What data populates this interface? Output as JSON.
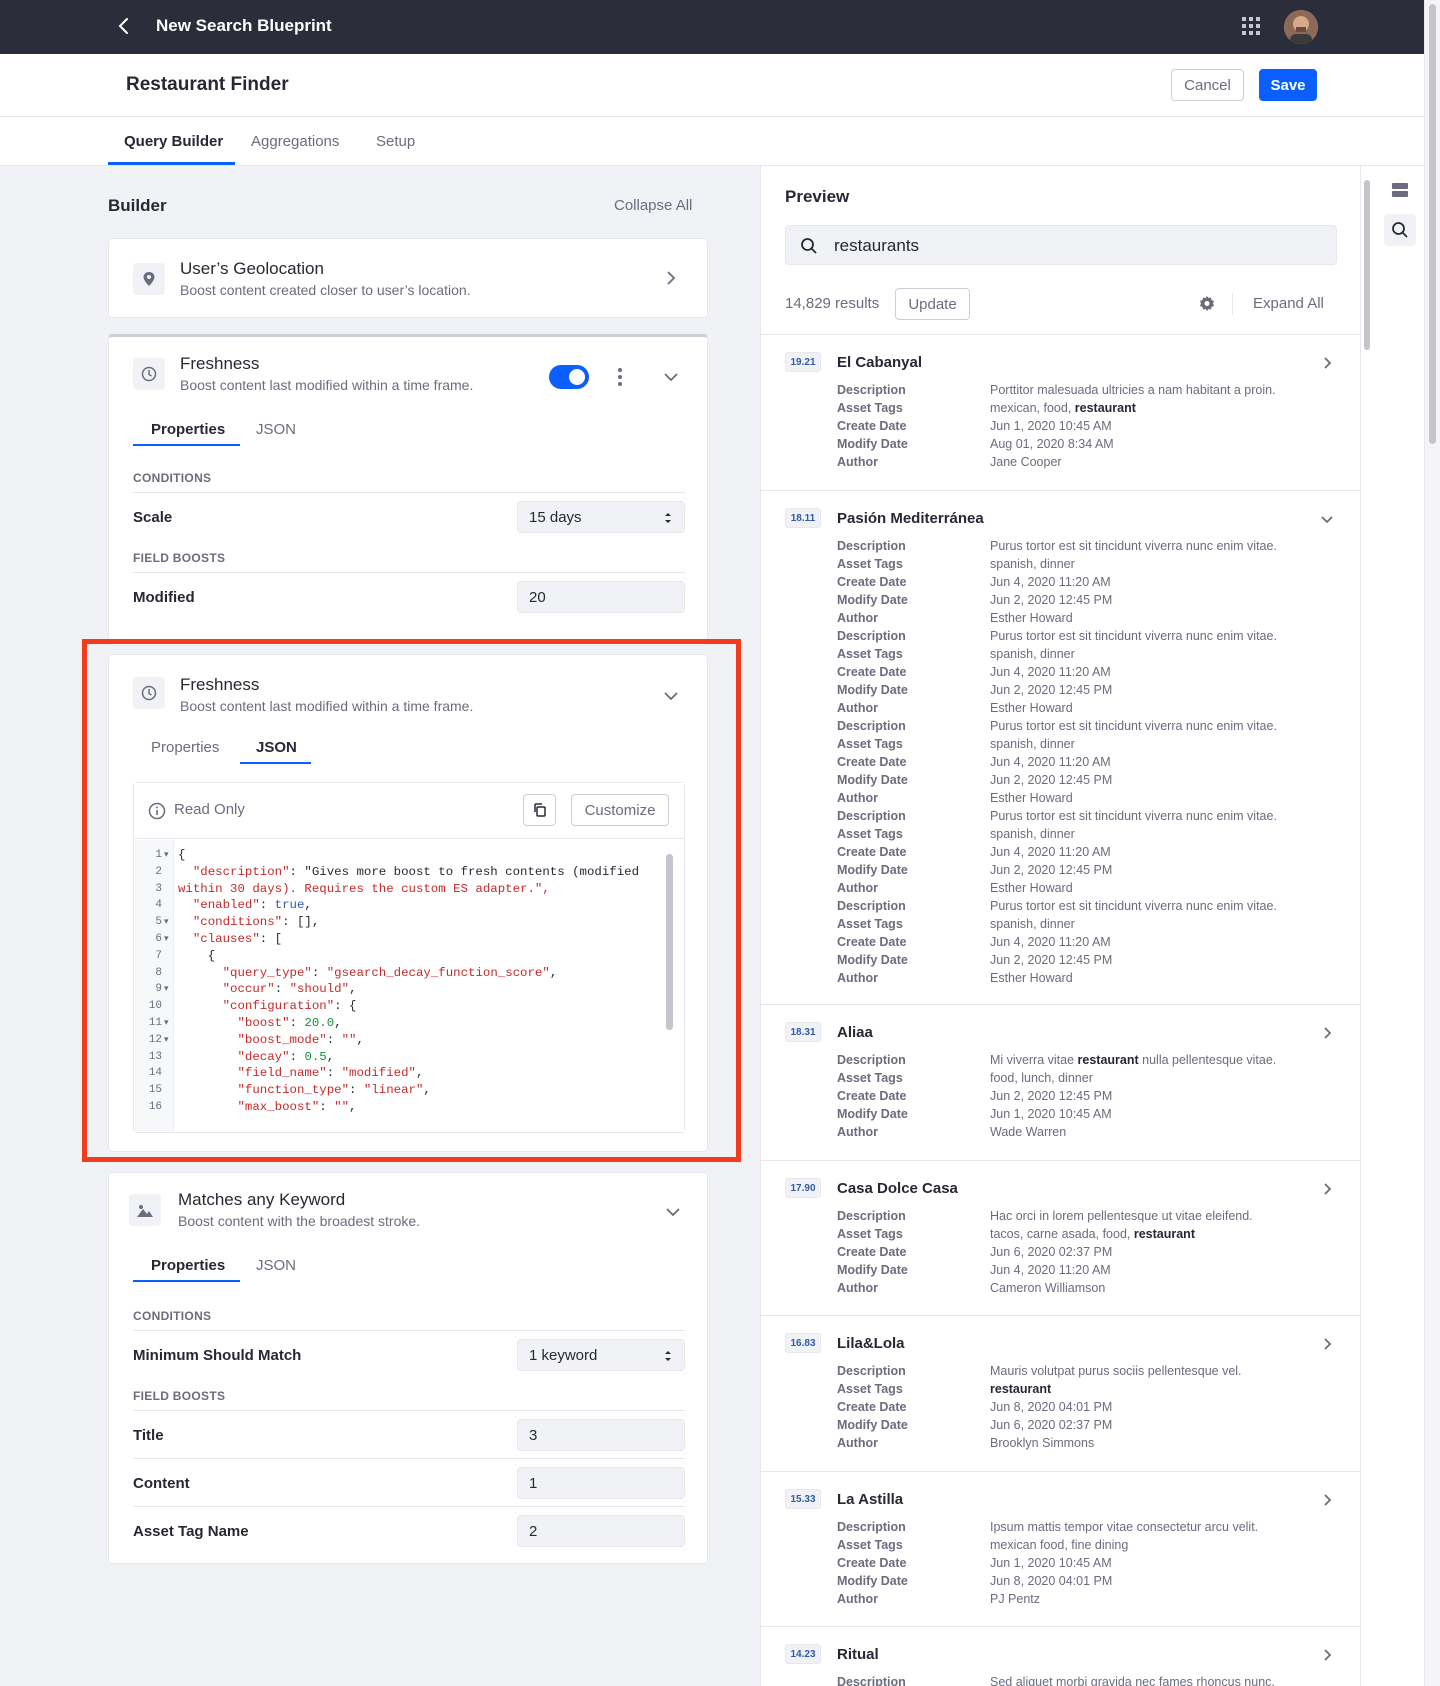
{
  "topbar": {
    "title": "New Search Blueprint"
  },
  "header": {
    "title": "Restaurant Finder",
    "cancel": "Cancel",
    "save": "Save"
  },
  "tabs": [
    {
      "label": "Query Builder"
    },
    {
      "label": "Aggregations"
    },
    {
      "label": "Setup"
    }
  ],
  "builder": {
    "title": "Builder",
    "collapse_all": "Collapse All",
    "geo": {
      "title": "User’s Geolocation",
      "subtitle": "Boost content created closer to user’s location."
    },
    "freshness1": {
      "title": "Freshness",
      "subtitle": "Boost content last modified within a time frame.",
      "enabled": true,
      "tab_properties": "Properties",
      "tab_json": "JSON",
      "conditions": "CONDITIONS",
      "scale_label": "Scale",
      "scale_value": "15 days",
      "field_boosts": "FIELD BOOSTS",
      "modified_label": "Modified",
      "modified_value": "20"
    },
    "freshness2": {
      "title": "Freshness",
      "subtitle": "Boost content last modified within a time frame.",
      "tab_properties": "Properties",
      "tab_json": "JSON",
      "read_only": "Read Only",
      "customize": "Customize",
      "code_lines": [
        {
          "n": "1",
          "fold": "▾",
          "text": "{"
        },
        {
          "n": "2",
          "fold": "",
          "text": "  \"description\": \"Gives more boost to fresh contents (modified"
        },
        {
          "n": "3",
          "fold": "",
          "text": "within 30 days). Requires the custom ES adapter.\","
        },
        {
          "n": "4",
          "fold": "",
          "text": "  \"enabled\": true,"
        },
        {
          "n": "5",
          "fold": "▾",
          "text": "  \"conditions\": [],"
        },
        {
          "n": "6",
          "fold": "▾",
          "text": "  \"clauses\": ["
        },
        {
          "n": "7",
          "fold": "",
          "text": "    {"
        },
        {
          "n": "8",
          "fold": "",
          "text": "      \"query_type\": \"gsearch_decay_function_score\","
        },
        {
          "n": "9",
          "fold": "▾",
          "text": "      \"occur\": \"should\","
        },
        {
          "n": "10",
          "fold": "",
          "text": "      \"configuration\": {"
        },
        {
          "n": "11",
          "fold": "▾",
          "text": "        \"boost\": 20.0,"
        },
        {
          "n": "12",
          "fold": "▾",
          "text": "        \"boost_mode\": \"\","
        },
        {
          "n": "13",
          "fold": "",
          "text": "        \"decay\": 0.5,"
        },
        {
          "n": "14",
          "fold": "",
          "text": "        \"field_name\": \"modified\","
        },
        {
          "n": "15",
          "fold": "",
          "text": "        \"function_type\": \"linear\","
        },
        {
          "n": "16",
          "fold": "",
          "text": "        \"max_boost\": \"\","
        }
      ]
    },
    "keyword": {
      "title": "Matches any Keyword",
      "subtitle": "Boost content with the broadest stroke.",
      "tab_properties": "Properties",
      "tab_json": "JSON",
      "conditions": "CONDITIONS",
      "msm_label": "Minimum Should Match",
      "msm_value": "1 keyword",
      "field_boosts": "FIELD BOOSTS",
      "title_label": "Title",
      "title_value": "3",
      "content_label": "Content",
      "content_value": "1",
      "asset_label": "Asset Tag Name",
      "asset_value": "2"
    }
  },
  "preview": {
    "title": "Preview",
    "query": "restaurants",
    "results_count": "14,829 results",
    "update": "Update",
    "expand_all": "Expand All",
    "results": [
      {
        "score": "19.21",
        "title": "El Cabanyal",
        "expanded": false,
        "props": [
          [
            "Description",
            "Porttitor malesuada ultricies a nam habitant a proin."
          ],
          [
            "Asset Tags",
            "mexican, food, <b>restaurant</b>"
          ],
          [
            "Create Date",
            "Jun 1, 2020 10:45 AM"
          ],
          [
            "Modify Date",
            "Aug 01, 2020 8:34 AM"
          ],
          [
            "Author",
            "Jane Cooper"
          ]
        ]
      },
      {
        "score": "18.11",
        "title": "Pasión Mediterránea",
        "expanded": true,
        "props": [
          [
            "Description",
            "Purus tortor est sit tincidunt viverra nunc enim vitae."
          ],
          [
            "Asset Tags",
            "spanish, dinner"
          ],
          [
            "Create Date",
            "Jun 4, 2020 11:20 AM"
          ],
          [
            "Modify Date",
            "Jun 2, 2020 12:45 PM"
          ],
          [
            "Author",
            "Esther Howard"
          ],
          [
            "Description",
            "Purus tortor est sit tincidunt viverra nunc enim vitae."
          ],
          [
            "Asset Tags",
            "spanish, dinner"
          ],
          [
            "Create Date",
            "Jun 4, 2020 11:20 AM"
          ],
          [
            "Modify Date",
            "Jun 2, 2020 12:45 PM"
          ],
          [
            "Author",
            "Esther Howard"
          ],
          [
            "Description",
            "Purus tortor est sit tincidunt viverra nunc enim vitae."
          ],
          [
            "Asset Tags",
            "spanish, dinner"
          ],
          [
            "Create Date",
            "Jun 4, 2020 11:20 AM"
          ],
          [
            "Modify Date",
            "Jun 2, 2020 12:45 PM"
          ],
          [
            "Author",
            "Esther Howard"
          ],
          [
            "Description",
            "Purus tortor est sit tincidunt viverra nunc enim vitae."
          ],
          [
            "Asset Tags",
            "spanish, dinner"
          ],
          [
            "Create Date",
            "Jun 4, 2020 11:20 AM"
          ],
          [
            "Modify Date",
            "Jun 2, 2020 12:45 PM"
          ],
          [
            "Author",
            "Esther Howard"
          ],
          [
            "Description",
            "Purus tortor est sit tincidunt viverra nunc enim vitae."
          ],
          [
            "Asset Tags",
            "spanish, dinner"
          ],
          [
            "Create Date",
            "Jun 4, 2020 11:20 AM"
          ],
          [
            "Modify Date",
            "Jun 2, 2020 12:45 PM"
          ],
          [
            "Author",
            "Esther Howard"
          ]
        ]
      },
      {
        "score": "18.31",
        "title": "Aliaa",
        "expanded": false,
        "props": [
          [
            "Description",
            "Mi viverra vitae <b>restaurant</b> nulla pellentesque vitae."
          ],
          [
            "Asset Tags",
            "food, lunch, dinner"
          ],
          [
            "Create Date",
            "Jun 2, 2020 12:45 PM"
          ],
          [
            "Modify Date",
            "Jun 1, 2020 10:45 AM"
          ],
          [
            "Author",
            "Wade Warren"
          ]
        ]
      },
      {
        "score": "17.90",
        "title": "Casa Dolce Casa",
        "expanded": false,
        "props": [
          [
            "Description",
            "Hac orci in lorem pellentesque ut vitae eleifend."
          ],
          [
            "Asset Tags",
            "tacos, carne asada, food, <b>restaurant</b>"
          ],
          [
            "Create Date",
            "Jun 6, 2020 02:37 PM"
          ],
          [
            "Modify Date",
            "Jun 4, 2020 11:20 AM"
          ],
          [
            "Author",
            "Cameron Williamson"
          ]
        ]
      },
      {
        "score": "16.83",
        "title": "Lila&Lola",
        "expanded": false,
        "props": [
          [
            "Description",
            "Mauris volutpat purus sociis pellentesque vel."
          ],
          [
            "Asset Tags",
            "<b>restaurant</b>"
          ],
          [
            "Create Date",
            "Jun 8, 2020 04:01 PM"
          ],
          [
            "Modify Date",
            "Jun 6, 2020 02:37 PM"
          ],
          [
            "Author",
            "Brooklyn Simmons"
          ]
        ]
      },
      {
        "score": "15.33",
        "title": "La Astilla",
        "expanded": false,
        "props": [
          [
            "Description",
            "Ipsum mattis tempor vitae consectetur arcu velit."
          ],
          [
            "Asset Tags",
            "mexican food, fine dining"
          ],
          [
            "Create Date",
            "Jun 1, 2020 10:45 AM"
          ],
          [
            "Modify Date",
            "Jun 8, 2020 04:01 PM"
          ],
          [
            "Author",
            "PJ Pentz"
          ]
        ]
      },
      {
        "score": "14.23",
        "title": "Ritual",
        "expanded": false,
        "props": [
          [
            "Description",
            "Sed aliquet morbi gravida nec fames rhoncus nunc."
          ]
        ]
      }
    ]
  },
  "colors": {
    "accent": "#0b5fff",
    "topbar": "#2b2d3a",
    "highlight": "#f33c1d"
  },
  "icons": [
    "back-icon",
    "apps-grid-icon",
    "avatar",
    "location-pin-icon",
    "clock-icon",
    "chevron-right-icon",
    "chevron-down-icon",
    "kebab-icon",
    "info-icon",
    "copy-icon",
    "image-icon",
    "search-icon",
    "gear-icon",
    "panel-icon"
  ]
}
